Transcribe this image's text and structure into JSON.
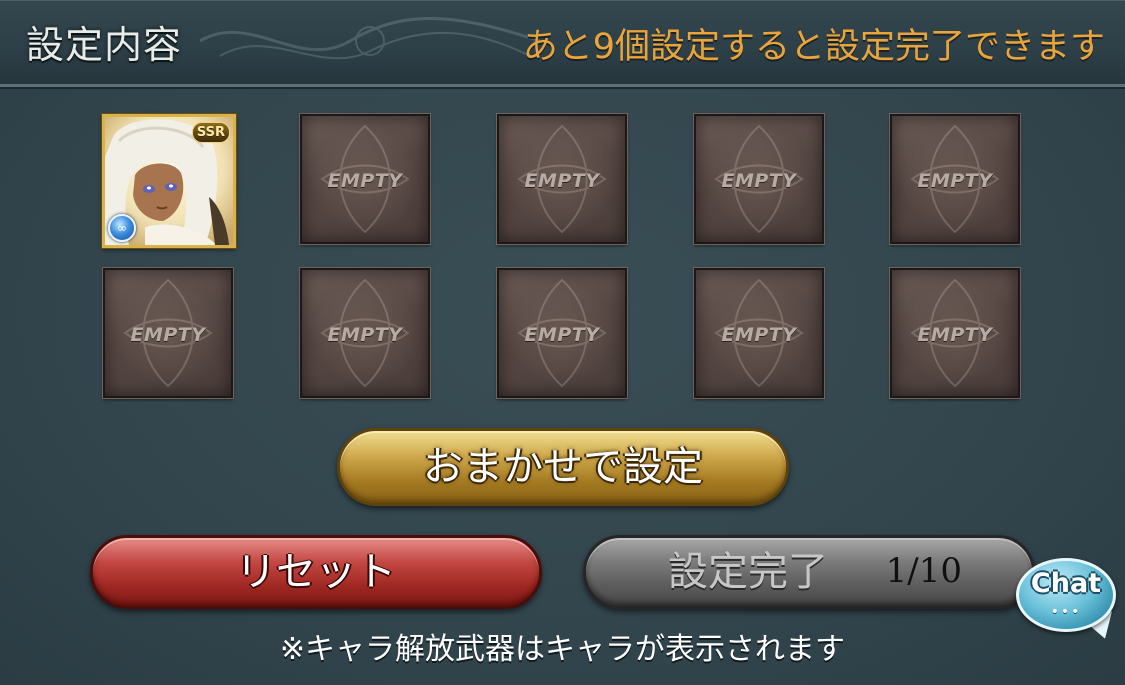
{
  "header": {
    "title": "設定内容",
    "notice": "あと9個設定すると設定完了できます"
  },
  "slots": [
    {
      "type": "character",
      "rarity": "SSR",
      "element": "water",
      "element_glyph": "∞"
    },
    {
      "type": "empty",
      "label": "EMPTY"
    },
    {
      "type": "empty",
      "label": "EMPTY"
    },
    {
      "type": "empty",
      "label": "EMPTY"
    },
    {
      "type": "empty",
      "label": "EMPTY"
    },
    {
      "type": "empty",
      "label": "EMPTY"
    },
    {
      "type": "empty",
      "label": "EMPTY"
    },
    {
      "type": "empty",
      "label": "EMPTY"
    },
    {
      "type": "empty",
      "label": "EMPTY"
    },
    {
      "type": "empty",
      "label": "EMPTY"
    }
  ],
  "buttons": {
    "auto_label": "おまかせで設定",
    "reset_label": "リセット",
    "complete_label": "設定完了",
    "complete_count": "1/10"
  },
  "chat": {
    "label": "Chat",
    "dots": "•••"
  },
  "footnote": "※キャラ解放武器はキャラが表示されます",
  "colors": {
    "notice": "#e9a43b",
    "gold_button": "#cfa84b",
    "red_button": "#c44844",
    "gray_button": "#7b7b7b",
    "chat_bubble": "#6cc2db"
  }
}
